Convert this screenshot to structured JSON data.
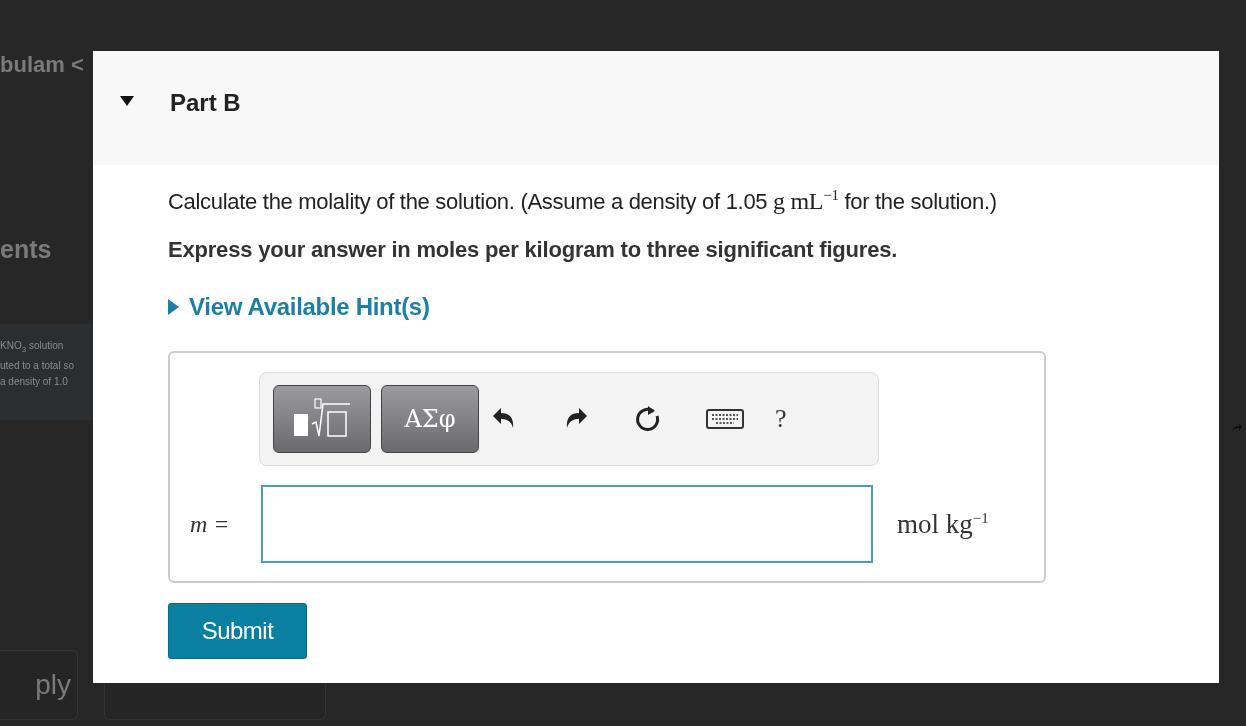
{
  "background": {
    "left_texts": [
      {
        "kind": "heading",
        "text": "bulam <"
      },
      {
        "kind": "section",
        "text": "ents"
      },
      {
        "kind": "snippet",
        "text": "KNO$_{3}$ solution"
      },
      {
        "kind": "snippet",
        "text": "uted to a total so"
      },
      {
        "kind": "snippet",
        "text": "a density of 1.0"
      }
    ],
    "buttons": [
      "ply"
    ]
  },
  "part": {
    "title": "Part B",
    "expanded": true,
    "question": [
      {
        "kind": "text",
        "text": "Calculate the molality of the solution. (Assume a density of 1.05 "
      },
      {
        "kind": "math",
        "text": "g mL$^{−1}$"
      },
      {
        "kind": "text",
        "text": " for the solution.)"
      }
    ],
    "instruction": "Express your answer in moles per kilogram to three significant figures.",
    "hint_link": {
      "label": "View Available Hint(s)",
      "expanded": false
    },
    "toolbar": {
      "symbols_label": "ΑΣφ",
      "help_label": "?"
    },
    "answer": {
      "variable": "m",
      "equals": "=",
      "unit": "mol kg$^{−1}$"
    },
    "submit": "Submit"
  }
}
